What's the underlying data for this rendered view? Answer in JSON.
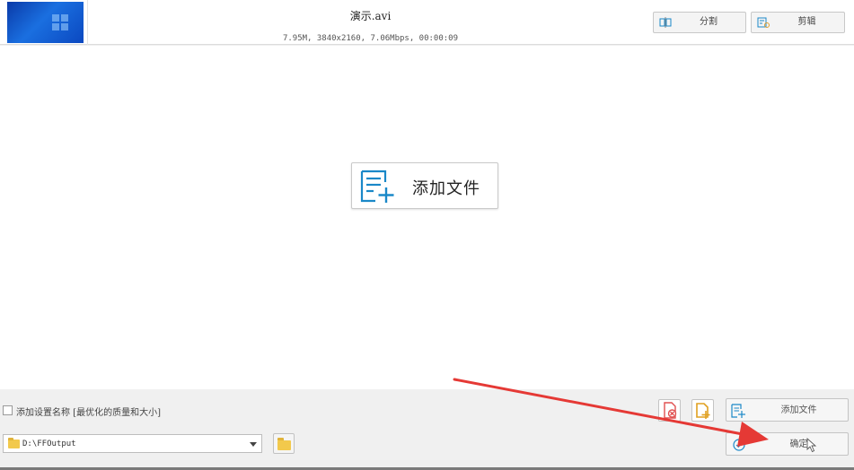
{
  "file": {
    "name": "演示.avi",
    "meta": "7.95M, 3840x2160, 7.06Mbps, 00:00:09",
    "split_label": "分割",
    "clip_label": "剪辑"
  },
  "main": {
    "add_file_label": "添加文件"
  },
  "bottom": {
    "name_option_label": "添加设置名称 [最优化的质量和大小]",
    "name_option_checked": false,
    "output_path": "D:\\FFOutput",
    "add_file_label": "添加文件",
    "confirm_label": "确定"
  },
  "colors": {
    "accent": "#1a88c8",
    "annotation_arrow": "#e53935",
    "clear_icon": "#e05050",
    "folder": "#f2c94c"
  },
  "icons": {
    "file_thumbnail": "video-thumbnail",
    "split": "split-icon",
    "clip": "clip-icon",
    "add_file": "add-file-icon",
    "clear": "clear-list-icon",
    "add_folder": "add-folder-icon",
    "browse": "folder-icon",
    "confirm": "check-circle-icon",
    "cursor": "mouse-cursor-icon"
  }
}
